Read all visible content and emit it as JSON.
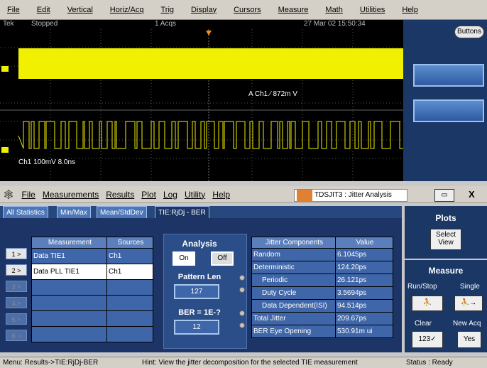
{
  "top_menu": [
    "File",
    "Edit",
    "Vertical",
    "Horiz/Acq",
    "Trig",
    "Display",
    "Cursors",
    "Measure",
    "Math",
    "Utilities",
    "Help"
  ],
  "scope_status": {
    "brand": "Tek",
    "state": "Stopped",
    "acqs": "1 Acqs",
    "datetime": "27 Mar 02 15:50:34",
    "buttons_label": "Buttons"
  },
  "screen": {
    "trigger_readout": "A  Ch1  ⁄  872m  V",
    "channel_readout": "Ch1  100mV  8.0ns"
  },
  "app_menu": [
    "File",
    "Measurements",
    "Results",
    "Plot",
    "Log",
    "Utility",
    "Help"
  ],
  "app_title": "TDSJIT3 : Jitter Analysis",
  "tabs": [
    "All Statistics",
    "Min/Max",
    "Mean/StdDev",
    "TIE:RjDj - BER"
  ],
  "measurements": {
    "headers": [
      "Measurement",
      "Sources"
    ],
    "row_buttons": [
      "1 >",
      "2 >",
      "3 >",
      "4 >",
      "5 >",
      "6 >"
    ],
    "rows": [
      [
        "Data TIE1",
        "Ch1"
      ],
      [
        "Data PLL TIE1",
        "Ch1"
      ],
      [
        "",
        ""
      ],
      [
        "",
        ""
      ],
      [
        "",
        ""
      ],
      [
        "",
        ""
      ]
    ]
  },
  "analysis": {
    "title": "Analysis",
    "on": "On",
    "off": "Off",
    "pattern_len_label": "Pattern Len",
    "pattern_len": "127",
    "ber_label": "BER = 1E-?",
    "ber": "12"
  },
  "jitter": {
    "headers": [
      "Jitter Components",
      "Value"
    ],
    "rows": [
      [
        "Random",
        "6.1045ps"
      ],
      [
        "Deterministic",
        "124.20ps"
      ],
      [
        "Periodic",
        "26.121ps"
      ],
      [
        "Duty Cycle",
        "3.5694ps"
      ],
      [
        "Data Dependent(ISI)",
        "94.514ps"
      ],
      [
        "Total Jitter",
        "209.67ps"
      ],
      [
        "BER Eye Opening",
        "530.91m ui"
      ]
    ]
  },
  "right": {
    "plots": "Plots",
    "select_view": "Select View",
    "measure": "Measure",
    "run_stop": "Run/Stop",
    "single": "Single",
    "clear": "Clear",
    "new_acq": "New Acq",
    "yes": "Yes"
  },
  "bottom": {
    "menu": "Menu: Results->TIE:RjDj-BER",
    "hint": "Hint: View the jitter decomposition for the selected TIE measurement",
    "status": "Status : Ready"
  },
  "colors": {
    "trace": "#f0f000",
    "panel": "#1c3566"
  }
}
